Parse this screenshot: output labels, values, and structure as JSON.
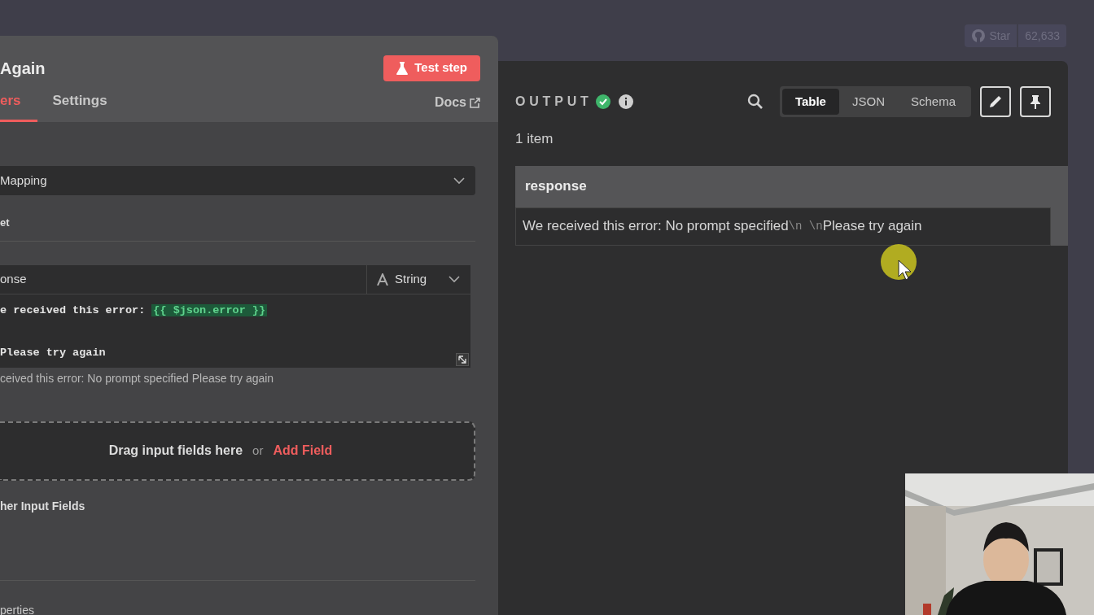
{
  "repo_badge": {
    "star_label": "Star",
    "count": "62,633"
  },
  "node": {
    "title": "Again",
    "test_button": "Test step",
    "tabs": [
      {
        "label": "ers",
        "selected": true
      },
      {
        "label": "Settings",
        "selected": false
      }
    ],
    "docs_link": "Docs"
  },
  "parameters": {
    "mode_select": {
      "value": "Mapping"
    },
    "section_label": "et",
    "fields": [
      {
        "name": "onse",
        "type": "String",
        "lines": [
          {
            "segments": [
              {
                "kind": "text",
                "text": "e received this error: "
              },
              {
                "kind": "expression",
                "text": "{{ $json.error }}"
              }
            ]
          },
          {
            "segments": [
              {
                "kind": "text",
                "text": "Please try again"
              }
            ]
          }
        ],
        "preview": "ceived this error: No prompt specified Please try again"
      }
    ],
    "drop_zone": {
      "hint": "Drag input fields here",
      "separator": "or",
      "add_link": "Add Field"
    },
    "other_fields_label": "her Input Fields",
    "properties_label": "perties"
  },
  "output": {
    "title": "OUTPUT",
    "succeeded": true,
    "views": [
      {
        "label": "Table",
        "selected": true
      },
      {
        "label": "JSON",
        "selected": false
      },
      {
        "label": "Schema",
        "selected": false
      }
    ],
    "item_count": "1 item",
    "table": {
      "columns": [
        "response"
      ],
      "rows": [
        [
          [
            {
              "kind": "text",
              "text": "We received this error: No prompt specified"
            },
            {
              "kind": "escape",
              "text": "\\n \\n"
            },
            {
              "kind": "text",
              "text": "Please try again"
            }
          ]
        ]
      ]
    }
  }
}
